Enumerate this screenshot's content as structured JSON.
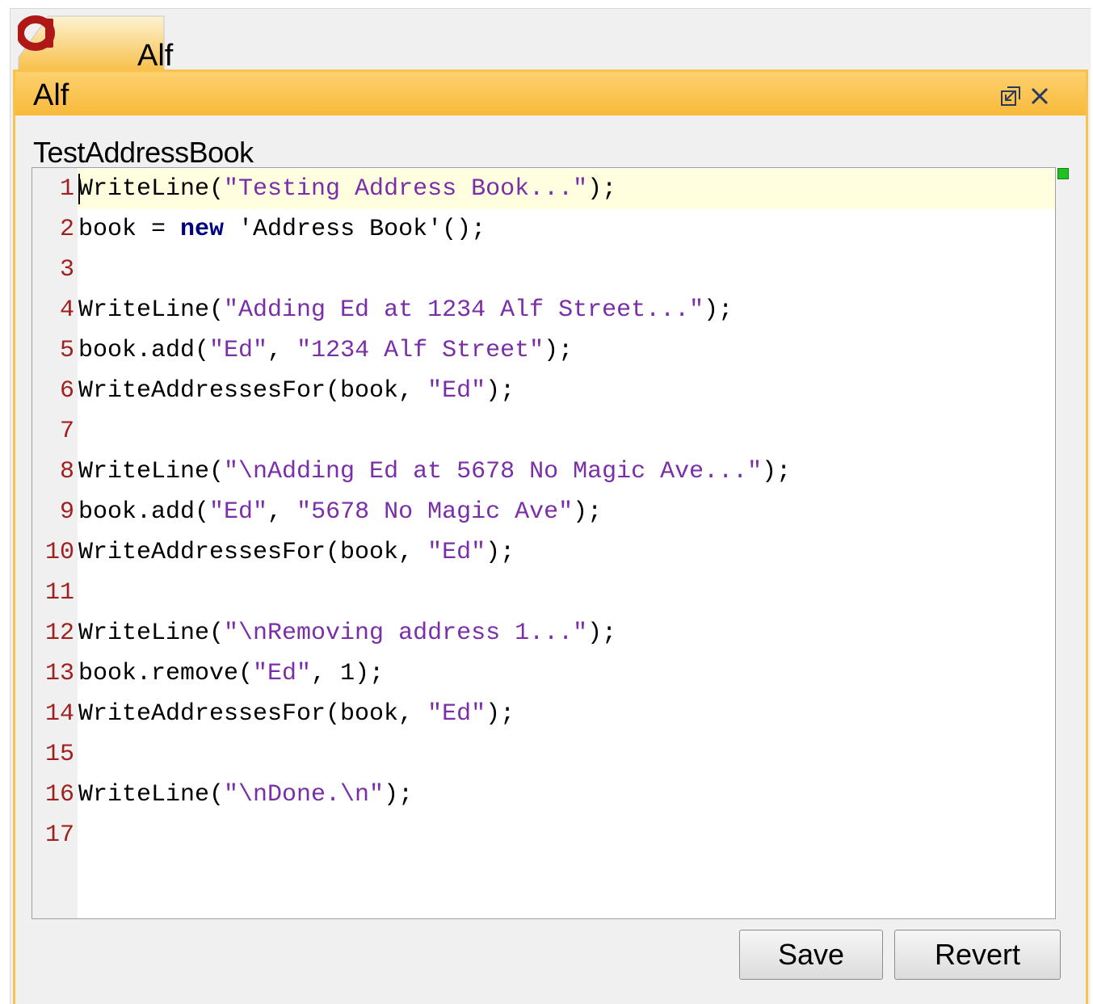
{
  "tab": {
    "label": "Alf",
    "logo": "alf-logo-icon",
    "logo_letter": "a"
  },
  "panel": {
    "title": "Alf",
    "icons": [
      "restore-window-icon",
      "close-icon"
    ]
  },
  "editor": {
    "label": "TestAddressBook",
    "current_line": 1,
    "lines": [
      {
        "n": "1",
        "tokens": [
          {
            "t": "WriteLine(",
            "k": "plain"
          },
          {
            "t": "\"Testing Address Book...\"",
            "k": "str"
          },
          {
            "t": ");",
            "k": "plain"
          }
        ]
      },
      {
        "n": "2",
        "tokens": [
          {
            "t": "book = ",
            "k": "plain"
          },
          {
            "t": "new",
            "k": "kw"
          },
          {
            "t": " 'Address Book'();",
            "k": "plain"
          }
        ]
      },
      {
        "n": "3",
        "tokens": []
      },
      {
        "n": "4",
        "tokens": [
          {
            "t": "WriteLine(",
            "k": "plain"
          },
          {
            "t": "\"Adding Ed at 1234 Alf Street...\"",
            "k": "str"
          },
          {
            "t": ");",
            "k": "plain"
          }
        ]
      },
      {
        "n": "5",
        "tokens": [
          {
            "t": "book.add(",
            "k": "plain"
          },
          {
            "t": "\"Ed\"",
            "k": "str"
          },
          {
            "t": ", ",
            "k": "plain"
          },
          {
            "t": "\"1234 Alf Street\"",
            "k": "str"
          },
          {
            "t": ");",
            "k": "plain"
          }
        ]
      },
      {
        "n": "6",
        "tokens": [
          {
            "t": "WriteAddressesFor(book, ",
            "k": "plain"
          },
          {
            "t": "\"Ed\"",
            "k": "str"
          },
          {
            "t": ");",
            "k": "plain"
          }
        ]
      },
      {
        "n": "7",
        "tokens": []
      },
      {
        "n": "8",
        "tokens": [
          {
            "t": "WriteLine(",
            "k": "plain"
          },
          {
            "t": "\"\\nAdding Ed at 5678 No Magic Ave...\"",
            "k": "str"
          },
          {
            "t": ");",
            "k": "plain"
          }
        ]
      },
      {
        "n": "9",
        "tokens": [
          {
            "t": "book.add(",
            "k": "plain"
          },
          {
            "t": "\"Ed\"",
            "k": "str"
          },
          {
            "t": ", ",
            "k": "plain"
          },
          {
            "t": "\"5678 No Magic Ave\"",
            "k": "str"
          },
          {
            "t": ");",
            "k": "plain"
          }
        ]
      },
      {
        "n": "10",
        "tokens": [
          {
            "t": "WriteAddressesFor(book, ",
            "k": "plain"
          },
          {
            "t": "\"Ed\"",
            "k": "str"
          },
          {
            "t": ");",
            "k": "plain"
          }
        ]
      },
      {
        "n": "11",
        "tokens": []
      },
      {
        "n": "12",
        "tokens": [
          {
            "t": "WriteLine(",
            "k": "plain"
          },
          {
            "t": "\"\\nRemoving address 1...\"",
            "k": "str"
          },
          {
            "t": ");",
            "k": "plain"
          }
        ]
      },
      {
        "n": "13",
        "tokens": [
          {
            "t": "book.remove(",
            "k": "plain"
          },
          {
            "t": "\"Ed\"",
            "k": "str"
          },
          {
            "t": ", 1);",
            "k": "plain"
          }
        ]
      },
      {
        "n": "14",
        "tokens": [
          {
            "t": "WriteAddressesFor(book, ",
            "k": "plain"
          },
          {
            "t": "\"Ed\"",
            "k": "str"
          },
          {
            "t": ");",
            "k": "plain"
          }
        ]
      },
      {
        "n": "15",
        "tokens": []
      },
      {
        "n": "16",
        "tokens": [
          {
            "t": "WriteLine(",
            "k": "plain"
          },
          {
            "t": "\"\\nDone.\\n\"",
            "k": "str"
          },
          {
            "t": ");",
            "k": "plain"
          }
        ]
      },
      {
        "n": "17",
        "tokens": []
      }
    ]
  },
  "buttons": {
    "save_label": "Save",
    "revert_label": "Revert"
  },
  "colors": {
    "accent": "#f9c24e",
    "header": "#fbc552",
    "string": "#7a2ea8",
    "keyword": "#000080",
    "line_number": "#a02020",
    "current_line": "#ffffe0",
    "logo": "#b01818",
    "marker": "#22c022"
  }
}
